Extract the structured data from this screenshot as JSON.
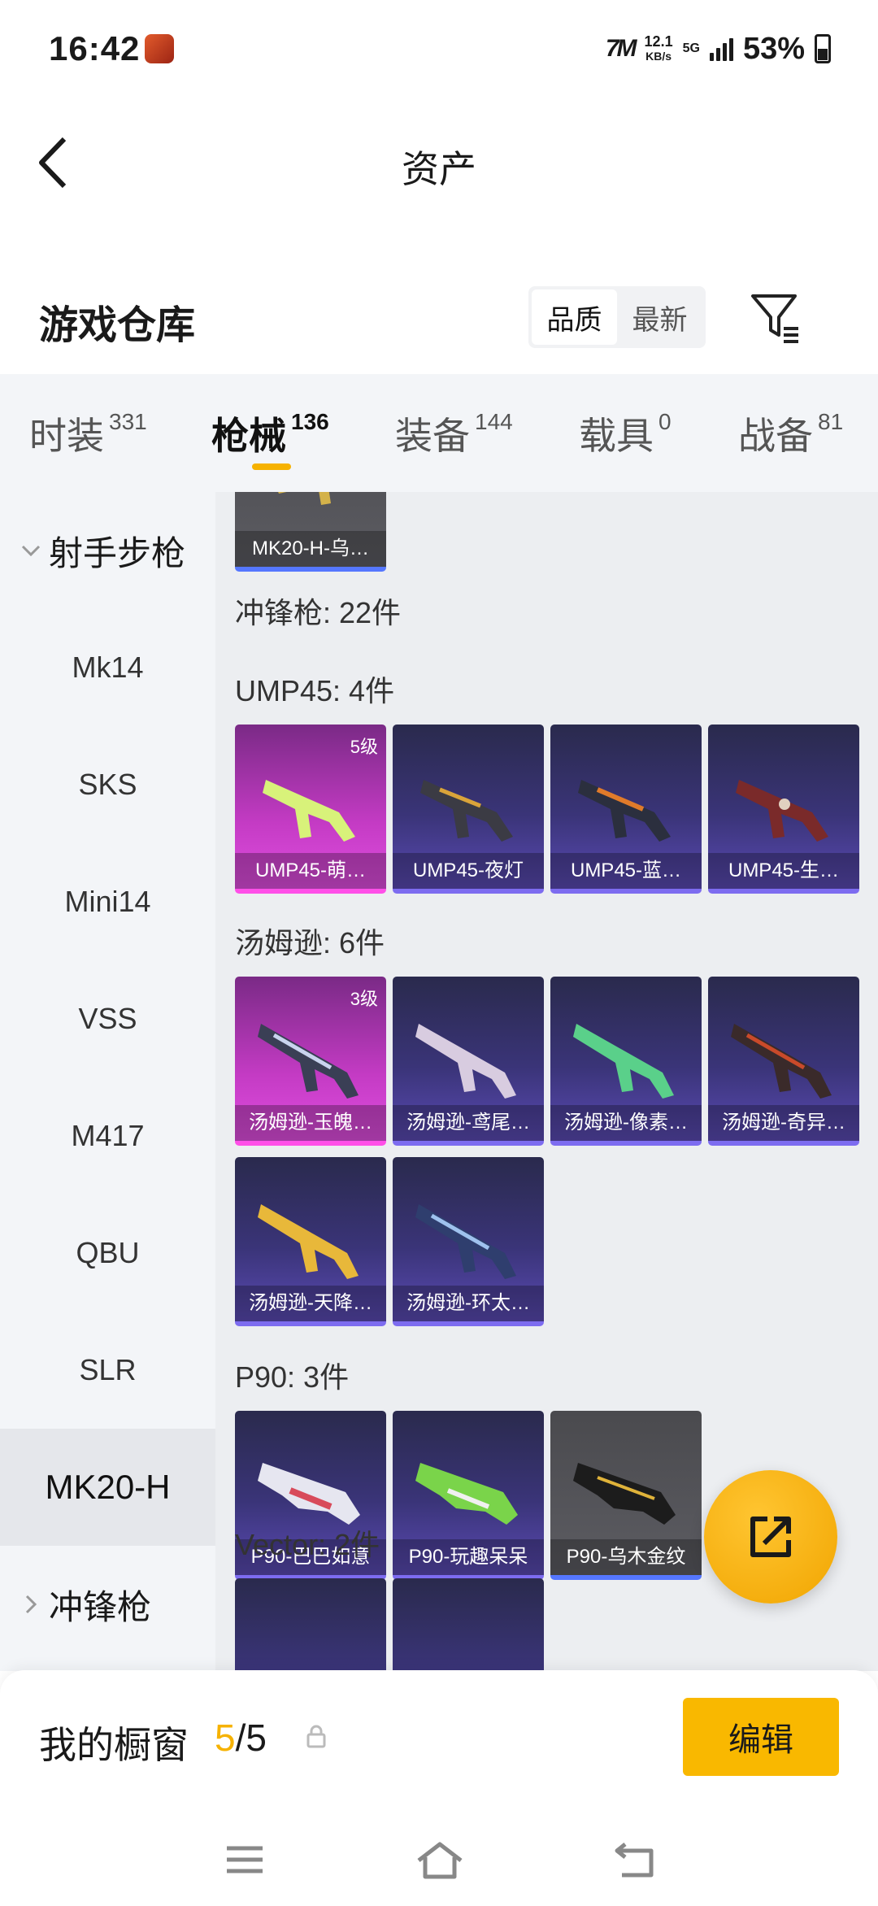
{
  "status_bar": {
    "time": "16:42",
    "brand_icon": "7M",
    "speed_value": "12.1",
    "speed_unit": "KB/s",
    "network": "5G",
    "battery": "53%"
  },
  "header": {
    "title": "资产"
  },
  "warehouse": {
    "title": "游戏仓库",
    "sort_options": [
      "品质",
      "最新"
    ],
    "active_sort": "品质"
  },
  "tabs": [
    {
      "label": "时装",
      "count": "331"
    },
    {
      "label": "枪械",
      "count": "136"
    },
    {
      "label": "装备",
      "count": "144"
    },
    {
      "label": "载具",
      "count": "0"
    },
    {
      "label": "战备",
      "count": "81"
    }
  ],
  "sidebar": {
    "group_1": "射手步枪",
    "items": [
      "Mk14",
      "SKS",
      "Mini14",
      "VSS",
      "M417",
      "QBU",
      "SLR",
      "MK20-H"
    ],
    "active_item": "MK20-H",
    "group_2": "冲锋枪"
  },
  "content": {
    "top_card": {
      "name": "MK20-H-乌…"
    },
    "smg_header": "冲锋枪: 22件",
    "sections": [
      {
        "label": "UMP45: 4件",
        "cards": [
          {
            "name": "UMP45-萌…",
            "level": "5级",
            "tier": "pink"
          },
          {
            "name": "UMP45-夜灯",
            "level": "",
            "tier": "purple"
          },
          {
            "name": "UMP45-蓝…",
            "level": "",
            "tier": "purple"
          },
          {
            "name": "UMP45-生…",
            "level": "",
            "tier": "purple"
          }
        ]
      },
      {
        "label": "汤姆逊: 6件",
        "cards": [
          {
            "name": "汤姆逊-玉魄…",
            "level": "3级",
            "tier": "pink"
          },
          {
            "name": "汤姆逊-鸢尾…",
            "level": "",
            "tier": "purple"
          },
          {
            "name": "汤姆逊-像素…",
            "level": "",
            "tier": "purple"
          },
          {
            "name": "汤姆逊-奇异…",
            "level": "",
            "tier": "purple"
          },
          {
            "name": "汤姆逊-天降…",
            "level": "",
            "tier": "purple"
          },
          {
            "name": "汤姆逊-环太…",
            "level": "",
            "tier": "purple"
          }
        ]
      },
      {
        "label": "P90: 3件",
        "cards": [
          {
            "name": "P90-巴巴如意",
            "level": "",
            "tier": "purple"
          },
          {
            "name": "P90-玩趣呆呆",
            "level": "",
            "tier": "purple"
          },
          {
            "name": "P90-乌木金纹",
            "level": "",
            "tier": "grey"
          }
        ]
      },
      {
        "label": "Vector: 2件",
        "cards": []
      }
    ]
  },
  "showcase": {
    "title": "我的橱窗",
    "current": "5",
    "separator": "/",
    "max": "5",
    "edit_label": "编辑"
  },
  "colors": {
    "accent": "#f6b200",
    "pink_tier": "#e04ee0",
    "purple_tier": "#5a4ab3"
  }
}
